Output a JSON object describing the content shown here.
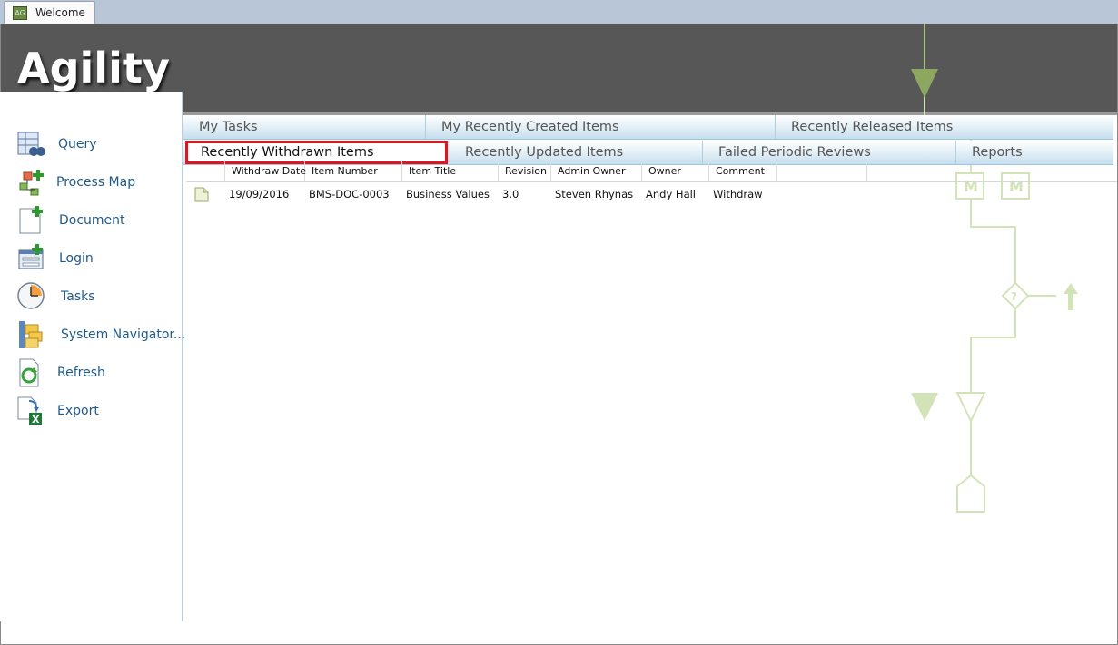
{
  "window": {
    "tab_title": "Welcome",
    "app_icon_text": "AG"
  },
  "banner": {
    "logo": "Agility"
  },
  "sidebar": {
    "items": [
      {
        "label": "Query",
        "icon": "binoculars-icon"
      },
      {
        "label": "Process Map",
        "icon": "process-map-icon"
      },
      {
        "label": "Document",
        "icon": "new-document-icon"
      },
      {
        "label": "Login",
        "icon": "login-form-icon"
      },
      {
        "label": "Tasks",
        "icon": "clock-icon"
      },
      {
        "label": "System Navigator...",
        "icon": "folders-icon"
      },
      {
        "label": "Refresh",
        "icon": "refresh-icon"
      },
      {
        "label": "Export",
        "icon": "excel-export-icon"
      }
    ]
  },
  "tabs": {
    "row1": [
      "My Tasks",
      "My Recently Created Items",
      "Recently Released Items"
    ],
    "row2": [
      "Recently Withdrawn Items",
      "Recently Updated Items",
      "Failed Periodic Reviews",
      "Reports"
    ],
    "active": "Recently Withdrawn Items"
  },
  "grid": {
    "columns": [
      "Withdraw Date",
      "Item Number",
      "Item Title",
      "Revision",
      "Admin Owner",
      "Owner",
      "Comment"
    ],
    "rows": [
      {
        "withdraw_date": "19/09/2016",
        "item_number": "BMS-DOC-0003",
        "item_title": "Business Values",
        "revision": "3.0",
        "admin_owner": "Steven Rhynas",
        "owner": "Andy Hall",
        "comment": "Withdraw"
      }
    ]
  },
  "watermark": {
    "marker1": "M",
    "marker2": "M",
    "decision": "?"
  },
  "colors": {
    "banner": "#575757",
    "accent_red": "#e0161e",
    "link_blue": "#1f5a8c",
    "watermark_green": "#c9dba8"
  }
}
